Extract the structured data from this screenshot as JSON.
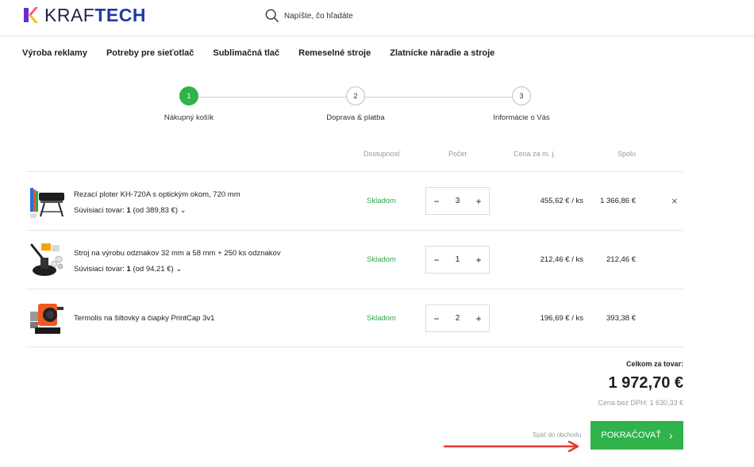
{
  "header": {
    "logo_light": "KRAF",
    "logo_bold": "TECH",
    "search_placeholder": "Napíšte, čo hľadáte"
  },
  "nav": [
    "Výroba reklamy",
    "Potreby pre sieťotlač",
    "Sublimačná tlač",
    "Remeselné stroje",
    "Zlatnícke náradie a stroje"
  ],
  "steps": [
    {
      "number": "1",
      "label": "Nákupný košík",
      "active": true
    },
    {
      "number": "2",
      "label": "Doprava & platba",
      "active": false
    },
    {
      "number": "3",
      "label": "Informácie o Vás",
      "active": false
    }
  ],
  "table": {
    "headers": {
      "availability": "Dostupnosť",
      "quantity": "Počet",
      "unit_price": "Cena za m. j.",
      "total": "Spolu"
    },
    "rows": [
      {
        "name": "Rezací ploter KH-720A s optickým okom, 720 mm",
        "related_label": "Súvisiaci tovar:",
        "related_count": "1",
        "related_price": "(od 389,83 €) ⌄",
        "stock": "Skladom",
        "qty": "3",
        "unit_price": "455,62 € / ks",
        "total": "1 366,86 €",
        "removable": true
      },
      {
        "name": "Stroj na výrobu odznakov 32 mm a 58 mm + 250 ks odznakov",
        "related_label": "Súvisiaci tovar:",
        "related_count": "1",
        "related_price": "(od 94,21 €) ⌄",
        "stock": "Skladom",
        "qty": "1",
        "unit_price": "212,46 € / ks",
        "total": "212,46 €",
        "removable": false
      },
      {
        "name": "Termolis na šiltovky a čiapky PrintCap 3v1",
        "related_label": "",
        "related_count": "",
        "related_price": "",
        "stock": "Skladom",
        "qty": "2",
        "unit_price": "196,69 € / ks",
        "total": "393,38 €",
        "removable": false
      }
    ]
  },
  "summary": {
    "label": "Celkom za tovar:",
    "value": "1 972,70 €",
    "net": "Cena bez DPH:  1 630,33 €",
    "back": "Späť do obchodu",
    "continue": "POKRAČOVAŤ"
  },
  "colors": {
    "accent": "#2fb34a",
    "brand": "#1e3aa8",
    "annotation_arrow": "#e53935"
  }
}
